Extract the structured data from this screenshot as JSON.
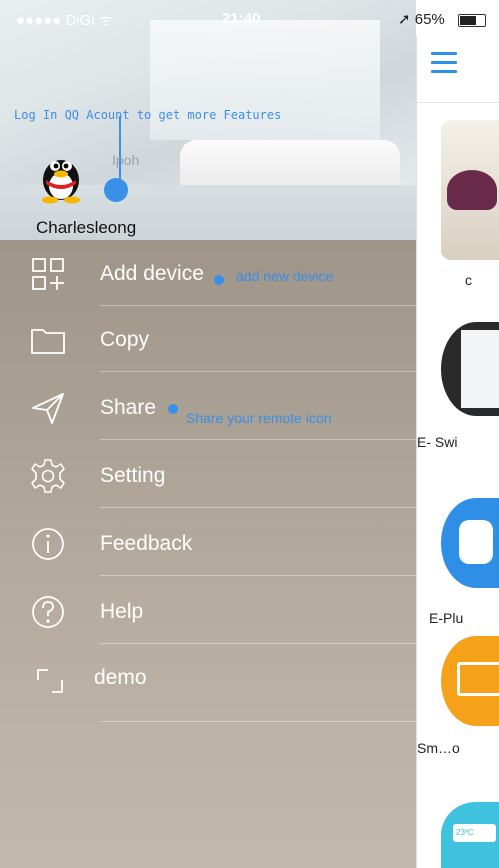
{
  "status_bar": {
    "carrier": "●●●●● DiGi ᯤ",
    "time": "21:40",
    "battery": "➚ 65%"
  },
  "profile": {
    "login_hint": "Log In QQ Acount to get more Features",
    "location": "Ipoh",
    "username": "Charlesleong"
  },
  "menu": {
    "items": [
      {
        "label": "Add device",
        "icon": "add-device-icon"
      },
      {
        "label": "Copy",
        "icon": "folder-icon"
      },
      {
        "label": "Share",
        "icon": "send-icon"
      },
      {
        "label": "Setting",
        "icon": "gear-icon"
      },
      {
        "label": "Feedback",
        "icon": "info-icon"
      },
      {
        "label": "Help",
        "icon": "help-icon"
      },
      {
        "label": "demo",
        "icon": "expand-icon"
      }
    ]
  },
  "annotations": {
    "add_new_device": "add new device",
    "share_remote": "Share your remote icon"
  },
  "right_panel": {
    "items": [
      {
        "label": "c"
      },
      {
        "label": "E- Swi"
      },
      {
        "label": "E-Plu"
      },
      {
        "label": "Sm…o"
      },
      {
        "label": ""
      }
    ],
    "ac_display": "23ºC"
  },
  "colors": {
    "accent": "#3a8fe6",
    "drawer": "#a0968a",
    "orange": "#f5a21a",
    "blue": "#2f8fe6"
  }
}
